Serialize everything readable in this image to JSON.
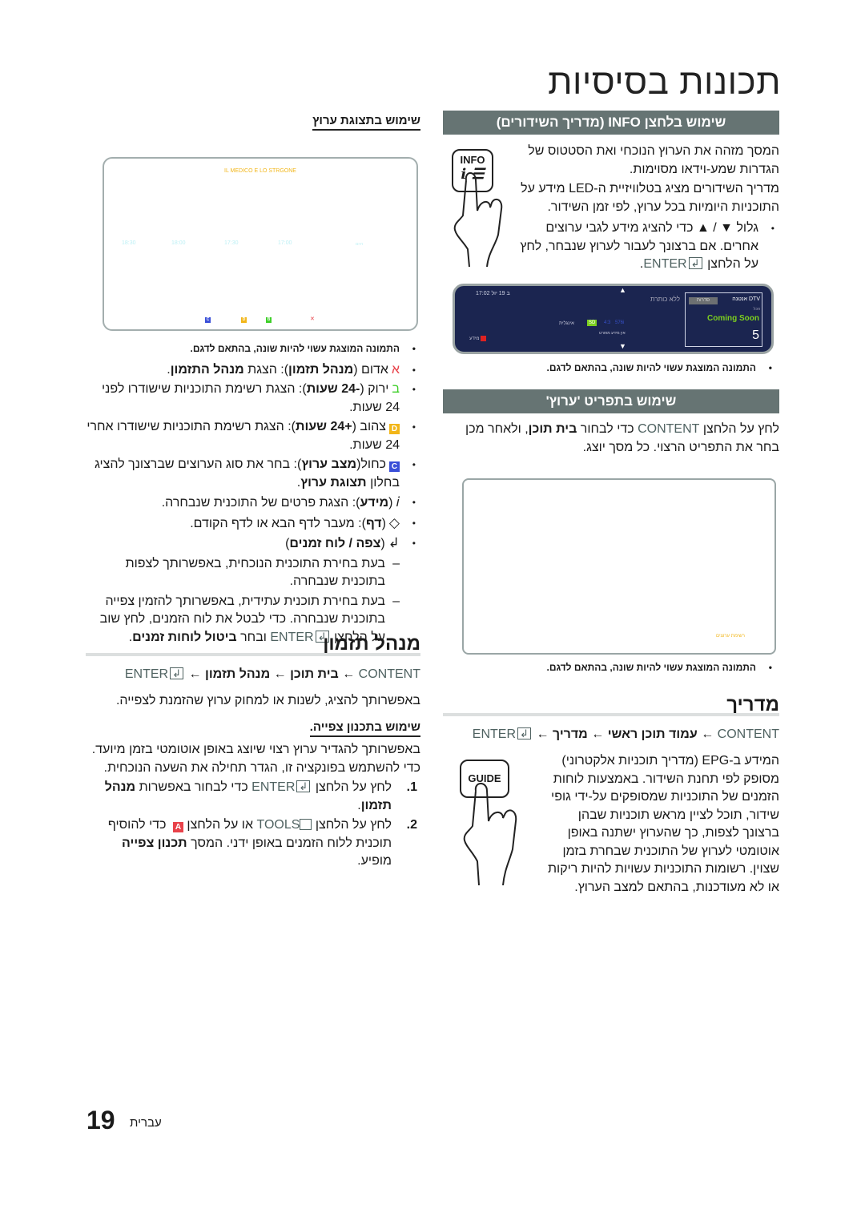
{
  "page": {
    "title": "תכונות בסיסיות",
    "footer_language": "עברית",
    "page_number": "19"
  },
  "info_section": {
    "header": "שימוש בלחצן INFO (מדריך השידורים)",
    "para1": "המסך מזהה את הערוץ הנוכחי ואת הסטטוס של הגדרות שמע-וידאו מסוימות.",
    "para2": "מדריך השידורים מציג בטלוויזיית ה-LED מידע על התוכניות היומיות בכל ערוץ, לפי זמן השידור.",
    "bullet_prefix": "גלול ▼ / ▲ כדי להציג מידע לגבי ערוצים אחרים. אם ברצונך לעבור לערוץ שנבחר, לחץ על הלחצן",
    "bullet_enter": "ENTER",
    "bullet_suffix": ".",
    "remote_label": "INFO",
    "note": "התמונה המוצגת עשוי להיות שונה, בהתאם לדגם.",
    "screen": {
      "datetime": "17:02 ב 19 יול",
      "no_title": "ללא כותרת",
      "source": "DTV אנטנה",
      "genre_badge": "סדרות",
      "genre_label": "הכל",
      "program": "Coming Soon",
      "channel": "5",
      "sd_badge": "SD",
      "aspect": "4:3",
      "resolution": "576i",
      "audio": "אינגלית",
      "no_details": "אין מידע מפורט",
      "info_key": "מידע"
    }
  },
  "channel_menu": {
    "header": "שימוש בתפריט 'ערוץ'",
    "para_pre": "לחץ על הלחצן",
    "para_content": "CONTENT",
    "para_mid": "כדי לבחור",
    "para_bold": "בית תוכן",
    "para_post": ", ולאחר מכן בחר את התפריט הרצוי. כל מסך יוצג.",
    "screen_label": "רשימת ערוצים",
    "note": "התמונה המוצגת עשוי להיות שונה, בהתאם לדגם."
  },
  "guide": {
    "title": "מדריך",
    "path": {
      "content": "CONTENT",
      "arrow": "←",
      "step1": "עמוד תוכן ראשי",
      "step2": "מדריך",
      "enter": "ENTER"
    },
    "remote_label": "GUIDE",
    "para": "המידע ב-EPG (מדריך תוכניות אלקטרוני) מסופק לפי תחנת השידור. באמצעות לוחות הזמנים של התוכניות שמסופקים על-ידי גופי שידור, תוכל לציין מראש תוכניות שבהן ברצונך לצפות, כך שהערוץ ישתנה באופן אוטומטי לערוץ של התוכנית שבחרת בזמן שצוין. רשומות התוכניות עשויות להיות ריקות או לא מעודכנות, בהתאם למצב הערוץ."
  },
  "channel_view": {
    "heading": "שימוש בתצוגת ערוץ",
    "screen": {
      "program_title": "IL MEDICO E LO STRGONE",
      "times": [
        "18:30",
        "18:00",
        "17:30",
        "17:00"
      ],
      "today": "היום",
      "keys": [
        {
          "letter": "C",
          "color": "#3a4fd8"
        },
        {
          "letter": "D",
          "color": "#f2b619"
        },
        {
          "letter": "B",
          "color": "#3fcf2a"
        },
        {
          "letter": "A",
          "color": "#e8424a"
        }
      ]
    },
    "note": "התמונה המוצגת עשוי להיות שונה, בהתאם לדגם.",
    "items": [
      {
        "key": "א",
        "key_color": "#e8424a",
        "text_pre": "אדום (",
        "bold1": "מנהל תזמון",
        "text_mid": "): הצגת ",
        "bold2": "מנהל התזמון",
        "text_post": "."
      },
      {
        "key": "ב",
        "key_color": "#3fcf2a",
        "text_pre": "ירוק (",
        "bold1": "-24 שעות",
        "text_mid": "): הצגת רשימת התוכניות שישודרו לפני 24 שעות.",
        "bold2": "",
        "text_post": ""
      },
      {
        "key": "D",
        "key_color": "#f2b619",
        "text_pre": "צהוב (",
        "bold1": "+24 שעות",
        "text_mid": "): הצגת רשימת התוכניות שישודרו אחרי 24 שעות.",
        "bold2": "",
        "text_post": ""
      },
      {
        "key": "C",
        "key_color": "#3a4fd8",
        "text_pre": "כחול(",
        "bold1": "מצב ערוץ",
        "text_mid": "): בחר את סוג הערוצים שברצונך להציג בחלון ",
        "bold2": "תצוגת ערוץ",
        "text_post": "."
      },
      {
        "key": "𝑖",
        "key_color": "",
        "text_pre": "(",
        "bold1": "מידע",
        "text_mid": "): הצגת פרטים של התוכנית שנבחרה.",
        "bold2": "",
        "text_post": ""
      },
      {
        "key": "◇",
        "key_color": "",
        "text_pre": "(",
        "bold1": "דף",
        "text_mid": "): מעבר לדף הבא או לדף הקודם.",
        "bold2": "",
        "text_post": ""
      },
      {
        "key": "↲",
        "key_color": "",
        "text_pre": "(",
        "bold1": "צפה / לוח זמנים",
        "text_mid": ")",
        "bold2": "",
        "text_post": ""
      }
    ],
    "sub_items": [
      "בעת בחירת התוכנית הנוכחית, באפשרותך לצפות בתוכנית שנבחרה.",
      "בעת בחירת תוכנית עתידית, באפשרותך להזמין צפייה בתוכנית שנבחרה. כדי לבטל את לוח הזמנים, לחץ שוב על הלחצן"
    ],
    "sub_enter": "ENTER",
    "sub_tail_pre": "ובחר",
    "sub_tail_bold": "ביטול לוחות זמנים",
    "sub_tail_post": "."
  },
  "schedule_manager": {
    "title": "מנהל תזמון",
    "path": {
      "content": "CONTENT",
      "arrow": "←",
      "step1": "בית תוכן",
      "step2": "מנהל תזמון",
      "enter": "ENTER"
    },
    "intro": "באפשרותך להציג, לשנות או למחוק ערוץ שהזמנת לצפייה.",
    "subheading": "שימוש בתכנון צפייה.",
    "para": "באפשרותך להגדיר ערוץ רצוי שיוצג באופן אוטומטי בזמן מיועד. כדי להשתמש בפונקציה זו, הגדר תחילה את השעה הנוכחית.",
    "steps": [
      {
        "num": "1.",
        "pre": "לחץ על הלחצן",
        "key": "ENTER",
        "mid": "כדי לבחור באפשרות",
        "bold": "מנהל תזמון",
        "post": "."
      },
      {
        "num": "2.",
        "pre": "לחץ על הלחצן",
        "key": "TOOLS",
        "mid": "או על הלחצן",
        "badge": "A",
        "mid2": "כדי להוסיף תוכנית ללוח הזמנים באופן ידני. המסך",
        "bold": "תכנון צפייה",
        "post": "מופיע."
      }
    ]
  }
}
